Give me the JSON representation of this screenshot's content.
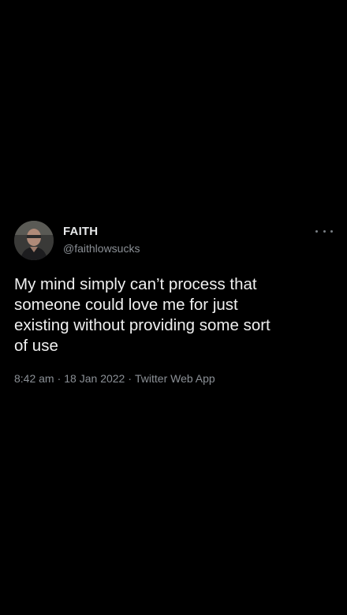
{
  "tweet": {
    "display_name": "FAITH",
    "handle": "@faithlowsucks",
    "text": "My mind simply can’t process that\nsomeone could love me for just\nexisting without providing some sort\nof use",
    "time": "8:42 am",
    "date": "18 Jan 2022",
    "source": "Twitter Web App",
    "separator": "·",
    "more_icon": "more-horizontal-icon",
    "avatar_icon": "profile-photo"
  },
  "colors": {
    "background": "#000000",
    "primary_text": "#e7e9ea",
    "secondary_text": "#8b9096"
  }
}
